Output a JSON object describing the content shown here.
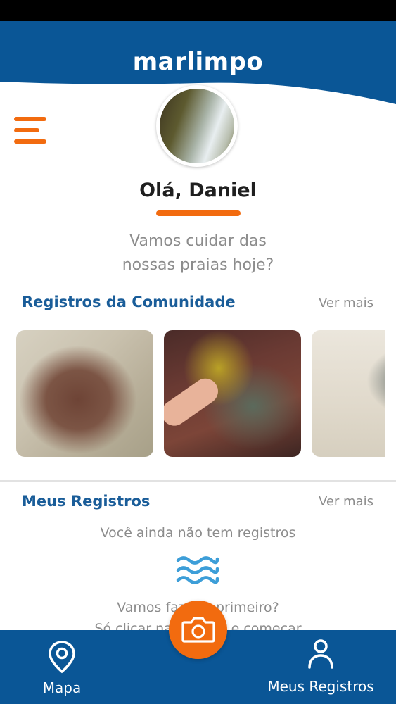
{
  "app": {
    "logo": "marlimpo"
  },
  "profile": {
    "greeting": "Olá, Daniel",
    "subtitle_line1": "Vamos cuidar das",
    "subtitle_line2": "nossas praias hoje?"
  },
  "community": {
    "title": "Registros da Comunidade",
    "see_more": "Ver mais",
    "photos": [
      "debris-on-sand",
      "rocks-with-debris",
      "fishing-net-on-sand"
    ]
  },
  "my_records": {
    "title": "Meus Registros",
    "see_more": "Ver mais",
    "empty_text": "Você ainda não tem registros",
    "cta_line1": "Vamos fazer o primeiro?",
    "cta_line2": "Só clicar na câmera e começar"
  },
  "bottom_nav": {
    "map_label": "Mapa",
    "records_label": "Meus Registros"
  },
  "colors": {
    "brand_blue": "#0a5696",
    "accent_orange": "#f26b0f",
    "title_blue": "#1a5d99",
    "muted_gray": "#8c8c8c"
  }
}
